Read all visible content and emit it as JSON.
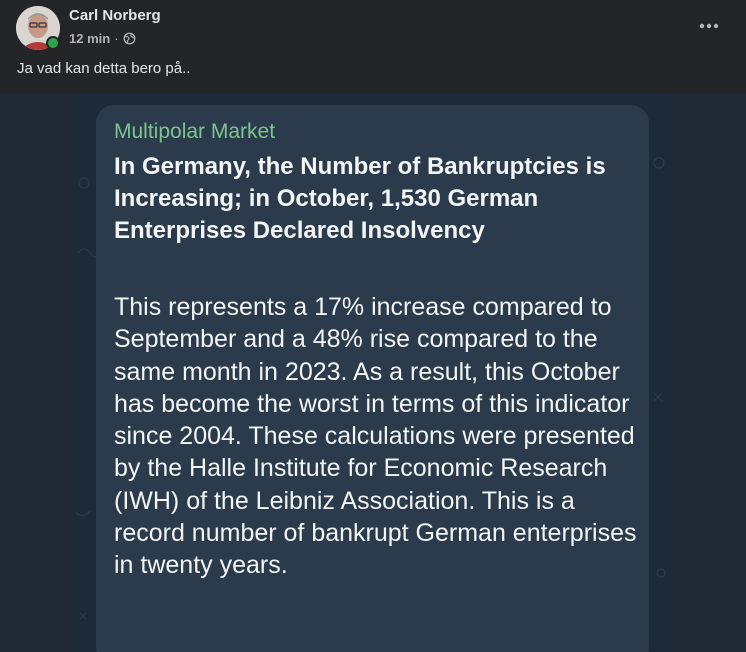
{
  "post": {
    "author": "Carl Norberg",
    "timestamp": "12 min",
    "separator": "·",
    "audience_icon": "globe-icon",
    "text": "Ja vad kan detta bero på..",
    "online": true
  },
  "image": {
    "source": "Multipolar Market",
    "headline": "In Germany, the Number of Bankruptcies is Increasing; in October, 1,530 German Enterprises Declared Insolvency",
    "body": "This represents a 17% increase compared to September and a 48% rise compared to the same month in 2023. As a result, this October has become the worst in terms of this indicator since 2004. These calculations were presented by the Halle Institute for Economic Research (IWH) of the Leibniz Association. This is a record number of bankrupt German enterprises in twenty years."
  },
  "colors": {
    "background": "#242526",
    "online": "#31a24c",
    "source_green": "#7dc48e",
    "card": "#2b3b4c"
  }
}
